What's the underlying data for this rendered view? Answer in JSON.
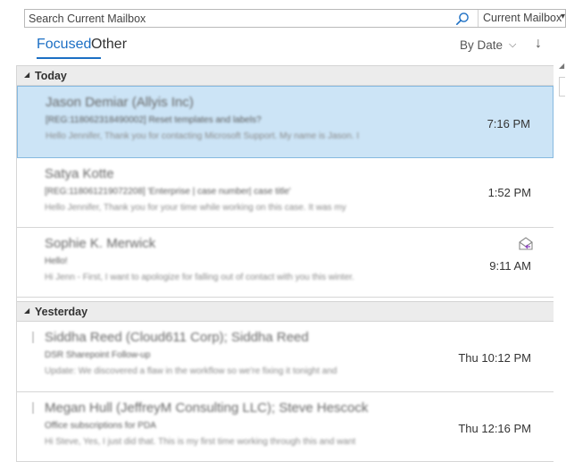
{
  "search": {
    "placeholder": "Search Current Mailbox",
    "scope_label": "Current Mailbox",
    "scope_chevron": "▾"
  },
  "tabs": {
    "focused": "Focused",
    "other": "Other"
  },
  "sort": {
    "label": "By Date",
    "chevron": "⌵",
    "direction_arrow": "↓"
  },
  "accent_color": "#1c6fc4",
  "selected_color": "#cce4f6",
  "groups": [
    {
      "label": "Today",
      "caret": "◢",
      "messages": [
        {
          "sender": "Jason Demiar (Allyis Inc)",
          "subject": "[REG:118062318490002] Reset templates and labels?",
          "preview": "Hello Jennifer, Thank you for contacting Microsoft Support. My name is Jason. I",
          "time": "7:16 PM",
          "selected": true
        },
        {
          "sender": "Satya Kotte",
          "subject": "[REG:118061219072208] 'Enterprise | case number| case title'",
          "preview": "Hello Jennifer,   Thank you for your time while working on this case. It was my",
          "time": "1:52 PM"
        },
        {
          "sender": "Sophie K. Merwick",
          "subject": "Hello!",
          "preview": "Hi Jenn -   First, I want to apologize for falling out of contact with you this winter.",
          "time": "9:11 AM",
          "icon": "envelope-reply-icon"
        }
      ]
    },
    {
      "label": "Yesterday",
      "caret": "◢",
      "messages": [
        {
          "sender": "Siddha Reed (Cloud611 Corp);  Siddha Reed",
          "subject": "DSR Sharepoint Follow-up",
          "preview": "Update: We discovered a flaw in the workflow so we're fixing it tonight and",
          "time": "Thu 10:12 PM"
        },
        {
          "sender": "Megan Hull (JeffreyM Consulting LLC);  Steve Hescock",
          "subject": "Office subscriptions for PDA",
          "preview": "Hi Steve,  Yes, I just did that. This is my first time working through this and want",
          "time": "Thu 12:16 PM"
        }
      ]
    }
  ]
}
